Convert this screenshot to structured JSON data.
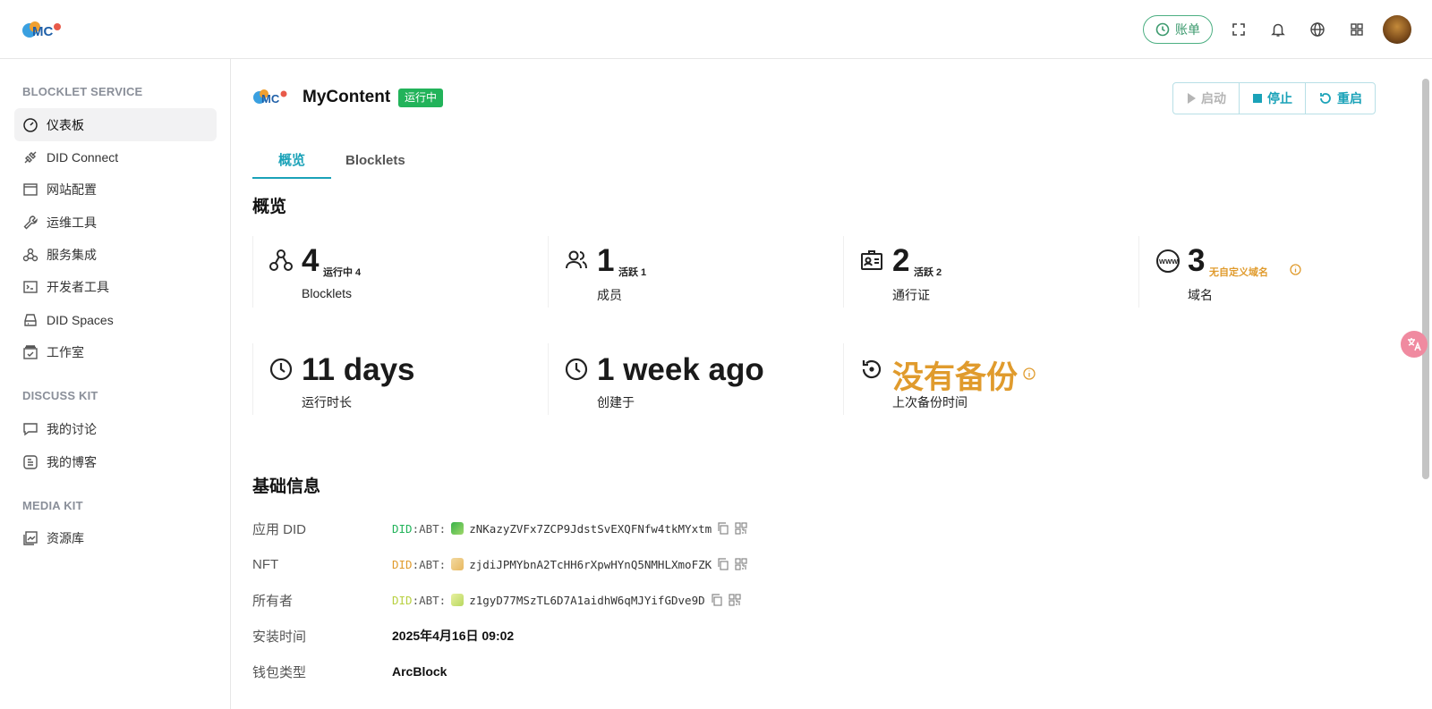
{
  "topbar": {
    "bill_label": "账单"
  },
  "sidebar": {
    "sections": [
      {
        "title": "BLOCKLET SERVICE"
      },
      {
        "title": "DISCUSS KIT"
      },
      {
        "title": "MEDIA KIT"
      }
    ],
    "items": [
      {
        "label": "仪表板",
        "icon": "dashboard-icon"
      },
      {
        "label": "DID Connect",
        "icon": "connect-icon"
      },
      {
        "label": "网站配置",
        "icon": "website-icon"
      },
      {
        "label": "运维工具",
        "icon": "wrench-icon"
      },
      {
        "label": "服务集成",
        "icon": "integration-icon"
      },
      {
        "label": "开发者工具",
        "icon": "terminal-icon"
      },
      {
        "label": "DID Spaces",
        "icon": "storage-icon"
      },
      {
        "label": "工作室",
        "icon": "studio-icon"
      },
      {
        "label": "我的讨论",
        "icon": "chat-icon"
      },
      {
        "label": "我的博客",
        "icon": "blog-icon"
      },
      {
        "label": "资源库",
        "icon": "library-icon"
      }
    ]
  },
  "app": {
    "name": "MyContent",
    "status": "运行中",
    "actions": {
      "start": "启动",
      "stop": "停止",
      "restart": "重启"
    }
  },
  "tabs": [
    {
      "label": "概览"
    },
    {
      "label": "Blocklets"
    }
  ],
  "overview": {
    "title": "概览",
    "stats": [
      {
        "value": "4",
        "sub": "运行中 4",
        "label": "Blocklets"
      },
      {
        "value": "1",
        "sub": "活跃 1",
        "label": "成员"
      },
      {
        "value": "2",
        "sub": "活跃 2",
        "label": "通行证"
      },
      {
        "value": "3",
        "sub": "无自定义域名",
        "label": "域名"
      }
    ],
    "metrics": [
      {
        "value": "11 days",
        "label": "运行时长"
      },
      {
        "value": "1 week ago",
        "label": "创建于"
      },
      {
        "value": "没有备份",
        "label": "上次备份时间"
      }
    ]
  },
  "basic_info": {
    "title": "基础信息",
    "rows": [
      {
        "key": "应用 DID",
        "did": "DID",
        "abt": ":ABT:",
        "value": "zNKazyZVFx7ZCP9JdstSvEXQFNfw4tkMYxtm"
      },
      {
        "key": "NFT",
        "did": "DID",
        "abt": ":ABT:",
        "value": "zjdiJPMYbnA2TcHH6rXpwHYnQ5NMHLXmoFZK"
      },
      {
        "key": "所有者",
        "did": "DID",
        "abt": ":ABT:",
        "value": "z1gyD77MSzTL6D7A1aidhW6qMJYifGDve9D"
      },
      {
        "key": "安装时间",
        "value": "2025年4月16日 09:02"
      },
      {
        "key": "钱包类型",
        "value": "ArcBlock"
      }
    ]
  },
  "colors": {
    "accent": "#1aa2b8",
    "success": "#22b35a",
    "warning": "#e09b2d"
  }
}
